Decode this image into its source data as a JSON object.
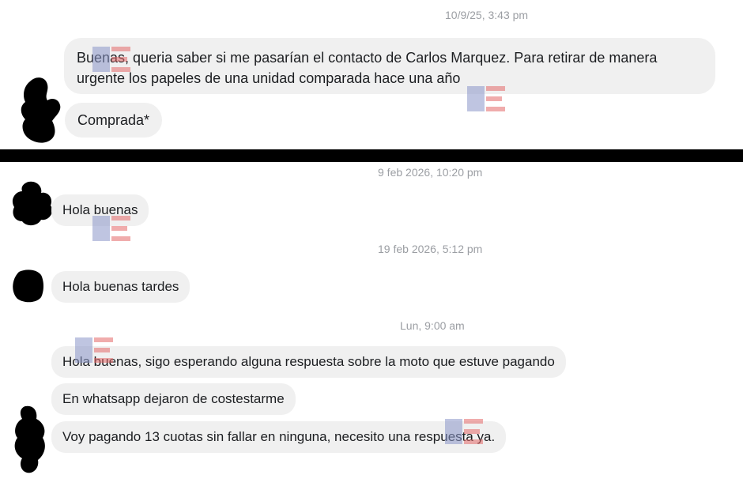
{
  "top_conversation": {
    "timestamp": "10/9/25, 3:43 pm",
    "messages": [
      {
        "text": "Buenas, queria saber si me pasarían el contacto de Carlos Marquez. Para retirar de manera urgente los papeles de una unidad comparada hace una año"
      },
      {
        "text": "Comprada*"
      }
    ]
  },
  "bottom_conversation": {
    "groups": [
      {
        "timestamp": "9 feb 2026, 10:20 pm",
        "messages": [
          "Hola buenas"
        ]
      },
      {
        "timestamp": "19 feb 2026, 5:12 pm",
        "messages": [
          "Hola buenas tardes"
        ]
      },
      {
        "timestamp": "Lun, 9:00 am",
        "messages": [
          "Hola buenas, sigo esperando alguna respuesta sobre la moto que estuve pagando",
          "En whatsapp dejaron de costestarme",
          "Voy pagando 13 cuotas sin fallar en ninguna, necesito una respuesta ya."
        ]
      }
    ]
  },
  "colors": {
    "bubble": "#f0f0f0",
    "timestamp": "#9b9ea3",
    "divider": "#000000",
    "watermark_blue": "#8b97c9",
    "watermark_red": "#e46a6a"
  },
  "icons": [
    "redacted-avatar",
    "watermark-logo"
  ]
}
